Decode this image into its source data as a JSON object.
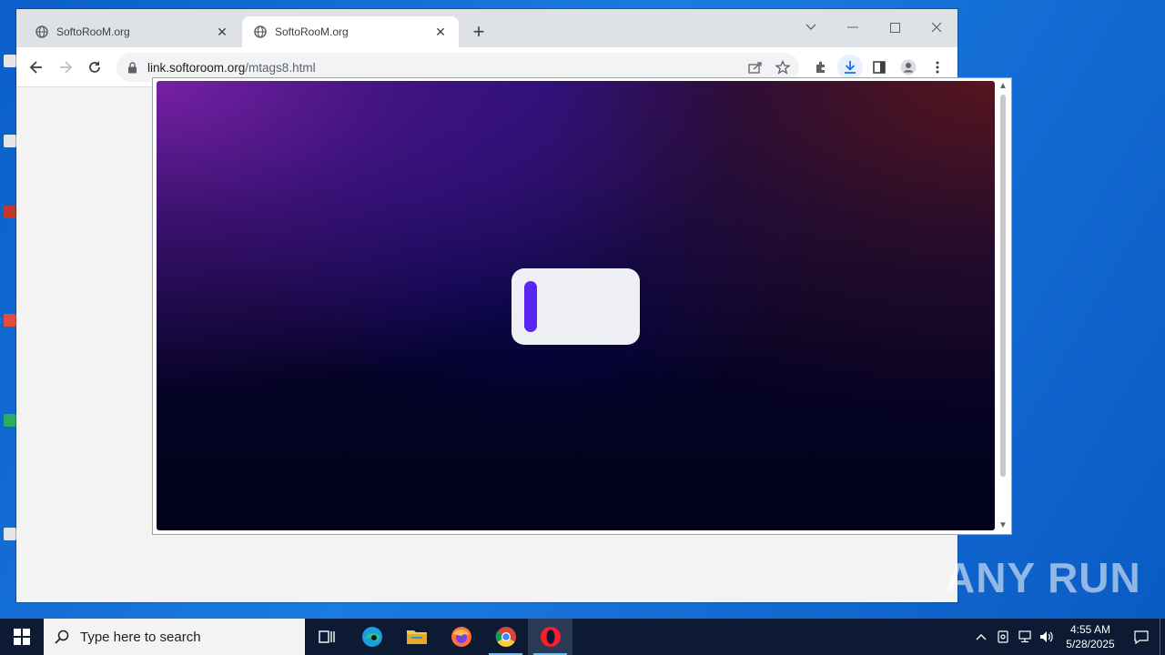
{
  "browser": {
    "tabs": [
      {
        "title": "SoftoRooM.org",
        "active": false
      },
      {
        "title": "SoftoRooM.org",
        "active": true
      }
    ],
    "address": {
      "host": "link.softoroom.org",
      "path": "/mtags8.html"
    }
  },
  "taskbar": {
    "search_placeholder": "Type here to search",
    "time": "4:55 AM",
    "date": "5/28/2025",
    "apps": [
      "task-view",
      "edge",
      "file-explorer",
      "firefox",
      "chrome",
      "opera"
    ]
  },
  "watermark": {
    "text": "ANY RUN"
  },
  "colors": {
    "loader_accent": "#5a25f2",
    "taskbar": "#0c1b33",
    "desktop": "#0b5fc9"
  }
}
